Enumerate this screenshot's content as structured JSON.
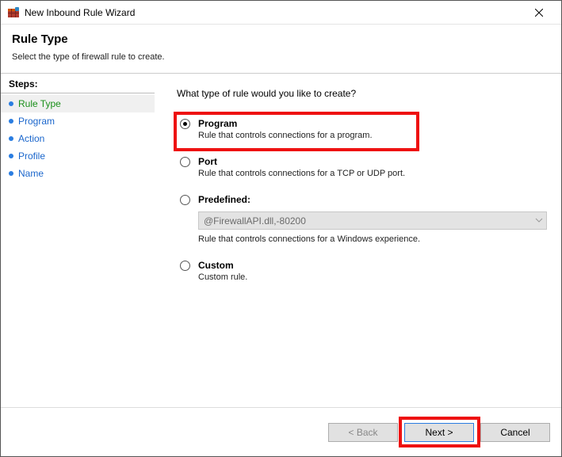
{
  "window": {
    "title": "New Inbound Rule Wizard"
  },
  "header": {
    "title": "Rule Type",
    "subtitle": "Select the type of firewall rule to create."
  },
  "sidebar": {
    "title": "Steps:",
    "items": [
      {
        "label": "Rule Type"
      },
      {
        "label": "Program"
      },
      {
        "label": "Action"
      },
      {
        "label": "Profile"
      },
      {
        "label": "Name"
      }
    ]
  },
  "content": {
    "question": "What type of rule would you like to create?",
    "options": {
      "program": {
        "label": "Program",
        "desc": "Rule that controls connections for a program."
      },
      "port": {
        "label": "Port",
        "desc": "Rule that controls connections for a TCP or UDP port."
      },
      "predefined": {
        "label": "Predefined:",
        "combo_value": "@FirewallAPI.dll,-80200",
        "desc": "Rule that controls connections for a Windows experience."
      },
      "custom": {
        "label": "Custom",
        "desc": "Custom rule."
      }
    }
  },
  "footer": {
    "back": "< Back",
    "next": "Next >",
    "cancel": "Cancel"
  }
}
